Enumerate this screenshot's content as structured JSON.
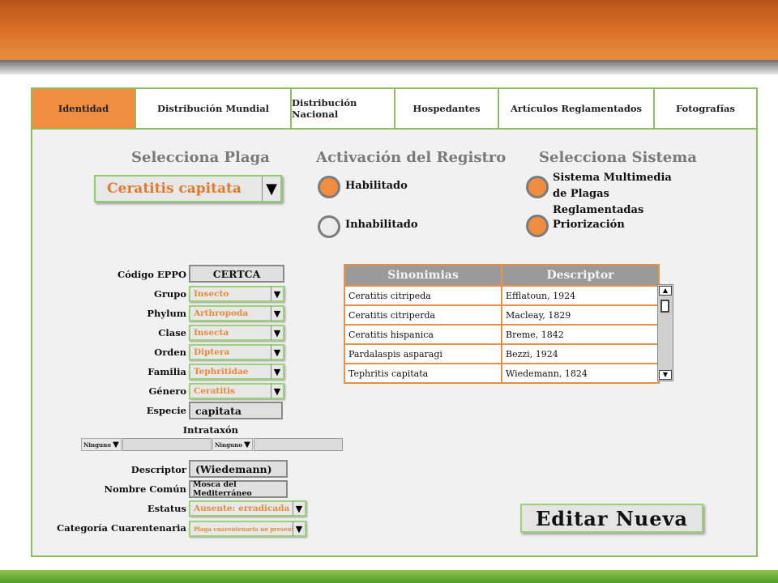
{
  "tabs": [
    "Identidad",
    "Distribución Mundial",
    "Distribución Nacional",
    "Hospedantes",
    "Artículos Reglamentados",
    "Fotografías"
  ],
  "headings": {
    "plaga": "Selecciona Plaga",
    "activacion": "Activación del Registro",
    "sistema": "Selecciona Sistema"
  },
  "plaga_select": {
    "value": "Ceratitis capitata"
  },
  "activacion": {
    "habilitado": "Habilitado",
    "inhabilitado": "Inhabilitado",
    "selected": "Habilitado"
  },
  "sistema": {
    "option1": "Sistema Multimedia de Plagas Reglamentadas",
    "option2": "Priorización"
  },
  "fields": {
    "codigo_label": "Código EPPO",
    "codigo_value": "CERTCA",
    "grupo_label": "Grupo",
    "grupo_value": "Insecto",
    "phylum_label": "Phylum",
    "phylum_value": "Arthropoda",
    "clase_label": "Clase",
    "clase_value": "Insecta",
    "orden_label": "Orden",
    "orden_value": "Diptera",
    "familia_label": "Familia",
    "familia_value": "Tephritidae",
    "genero_label": "Género",
    "genero_value": "Ceratitis",
    "especie_label": "Especie",
    "especie_value": "capitata",
    "intrataxon_label": "Intrataxón",
    "intrataxon_select1": "Ninguno",
    "intrataxon_select2": "Ninguno",
    "descriptor_label": "Descriptor",
    "descriptor_value": "(Wiedemann)",
    "nombre_label": "Nombre Común",
    "nombre_value": "Mosca del Mediterráneo",
    "estatus_label": "Estatus",
    "estatus_value": "Ausente: erradicada",
    "categoria_label": "Categoría Cuarentenaria",
    "categoria_value": "Plaga cuarentenaria no presente"
  },
  "synonyms": {
    "headers": [
      "Sinonimias",
      "Descriptor"
    ],
    "rows": [
      [
        "Ceratitis citripeda",
        "Efflatoun, 1924"
      ],
      [
        "Ceratitis citriperda",
        "Macleay, 1829"
      ],
      [
        "Ceratitis hispanica",
        "Breme, 1842"
      ],
      [
        "Pardalaspis asparagi",
        "Bezzi, 1924"
      ],
      [
        "Tephritis capitata",
        "Wiedemann, 1824"
      ]
    ]
  },
  "edit_button": "Editar Nueva",
  "colors": {
    "accent": "#f08d3e",
    "border_green": "#8fbc61",
    "header_orange": "#d96e28"
  }
}
